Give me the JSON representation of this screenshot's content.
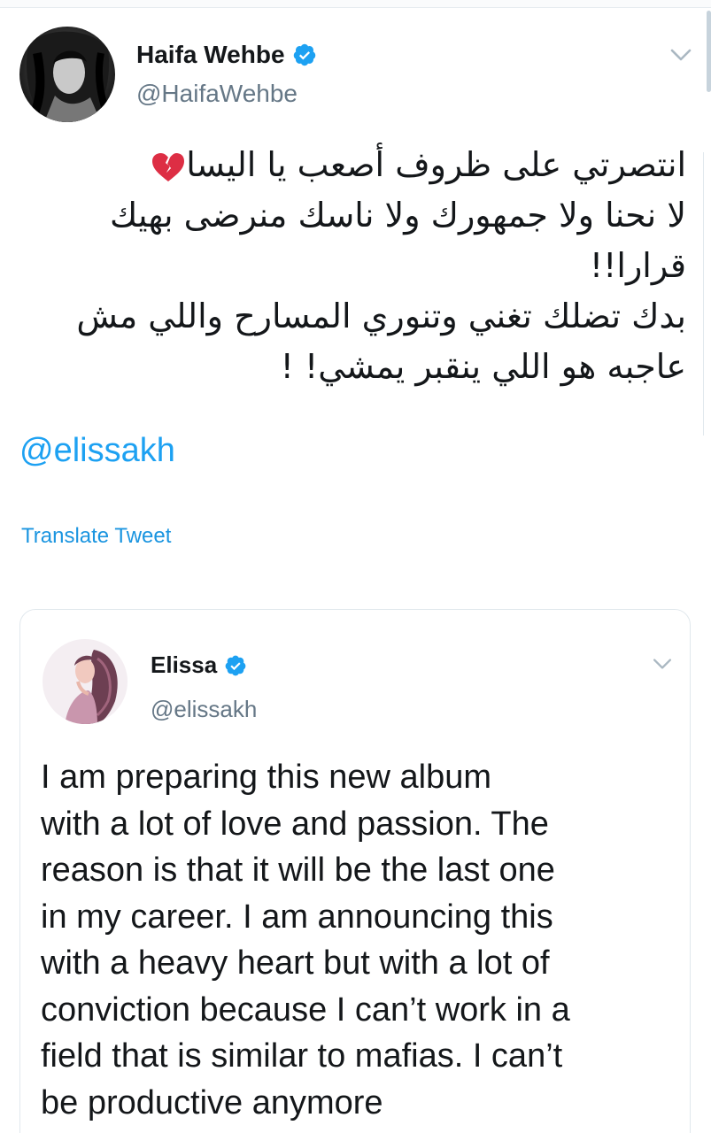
{
  "tweet": {
    "author": {
      "name": "Haifa Wehbe",
      "handle": "@HaifaWehbe",
      "verified": true
    },
    "text_lines": [
      "انتصرتي على ظروف أصعب يا اليسا",
      "لا نحنا ولا جمهورك ولا ناسك منرضى بهيك",
      "قرارا!!",
      "بدك تضلك تغني وتنوري المسارح  واللي مش",
      "عاجبه هو اللي ينقبر يمشي! !"
    ],
    "emoji": "broken-heart",
    "mention": "@elissakh",
    "translate_label": "Translate Tweet"
  },
  "quoted_tweet": {
    "author": {
      "name": "Elissa",
      "handle": "@elissakh",
      "verified": true
    },
    "text_lines": [
      "I am preparing this new album",
      "with a lot of love and passion. The",
      "reason is that it will be the last one",
      "in my career. I am announcing this",
      "with a heavy heart but with a lot of",
      "conviction because I can’t work in a",
      "field that is similar to mafias. I can’t",
      "be productive anymore"
    ]
  },
  "colors": {
    "link_blue": "#1da1f2",
    "verified_blue": "#1da1f2",
    "secondary_text": "#657786",
    "primary_text": "#14171a",
    "border": "#e1e8ed",
    "heart_red": "#dd2e44"
  },
  "icons": {
    "verified": "verified-badge-icon",
    "menu": "chevron-down-icon",
    "emoji": "broken-heart-emoji"
  }
}
